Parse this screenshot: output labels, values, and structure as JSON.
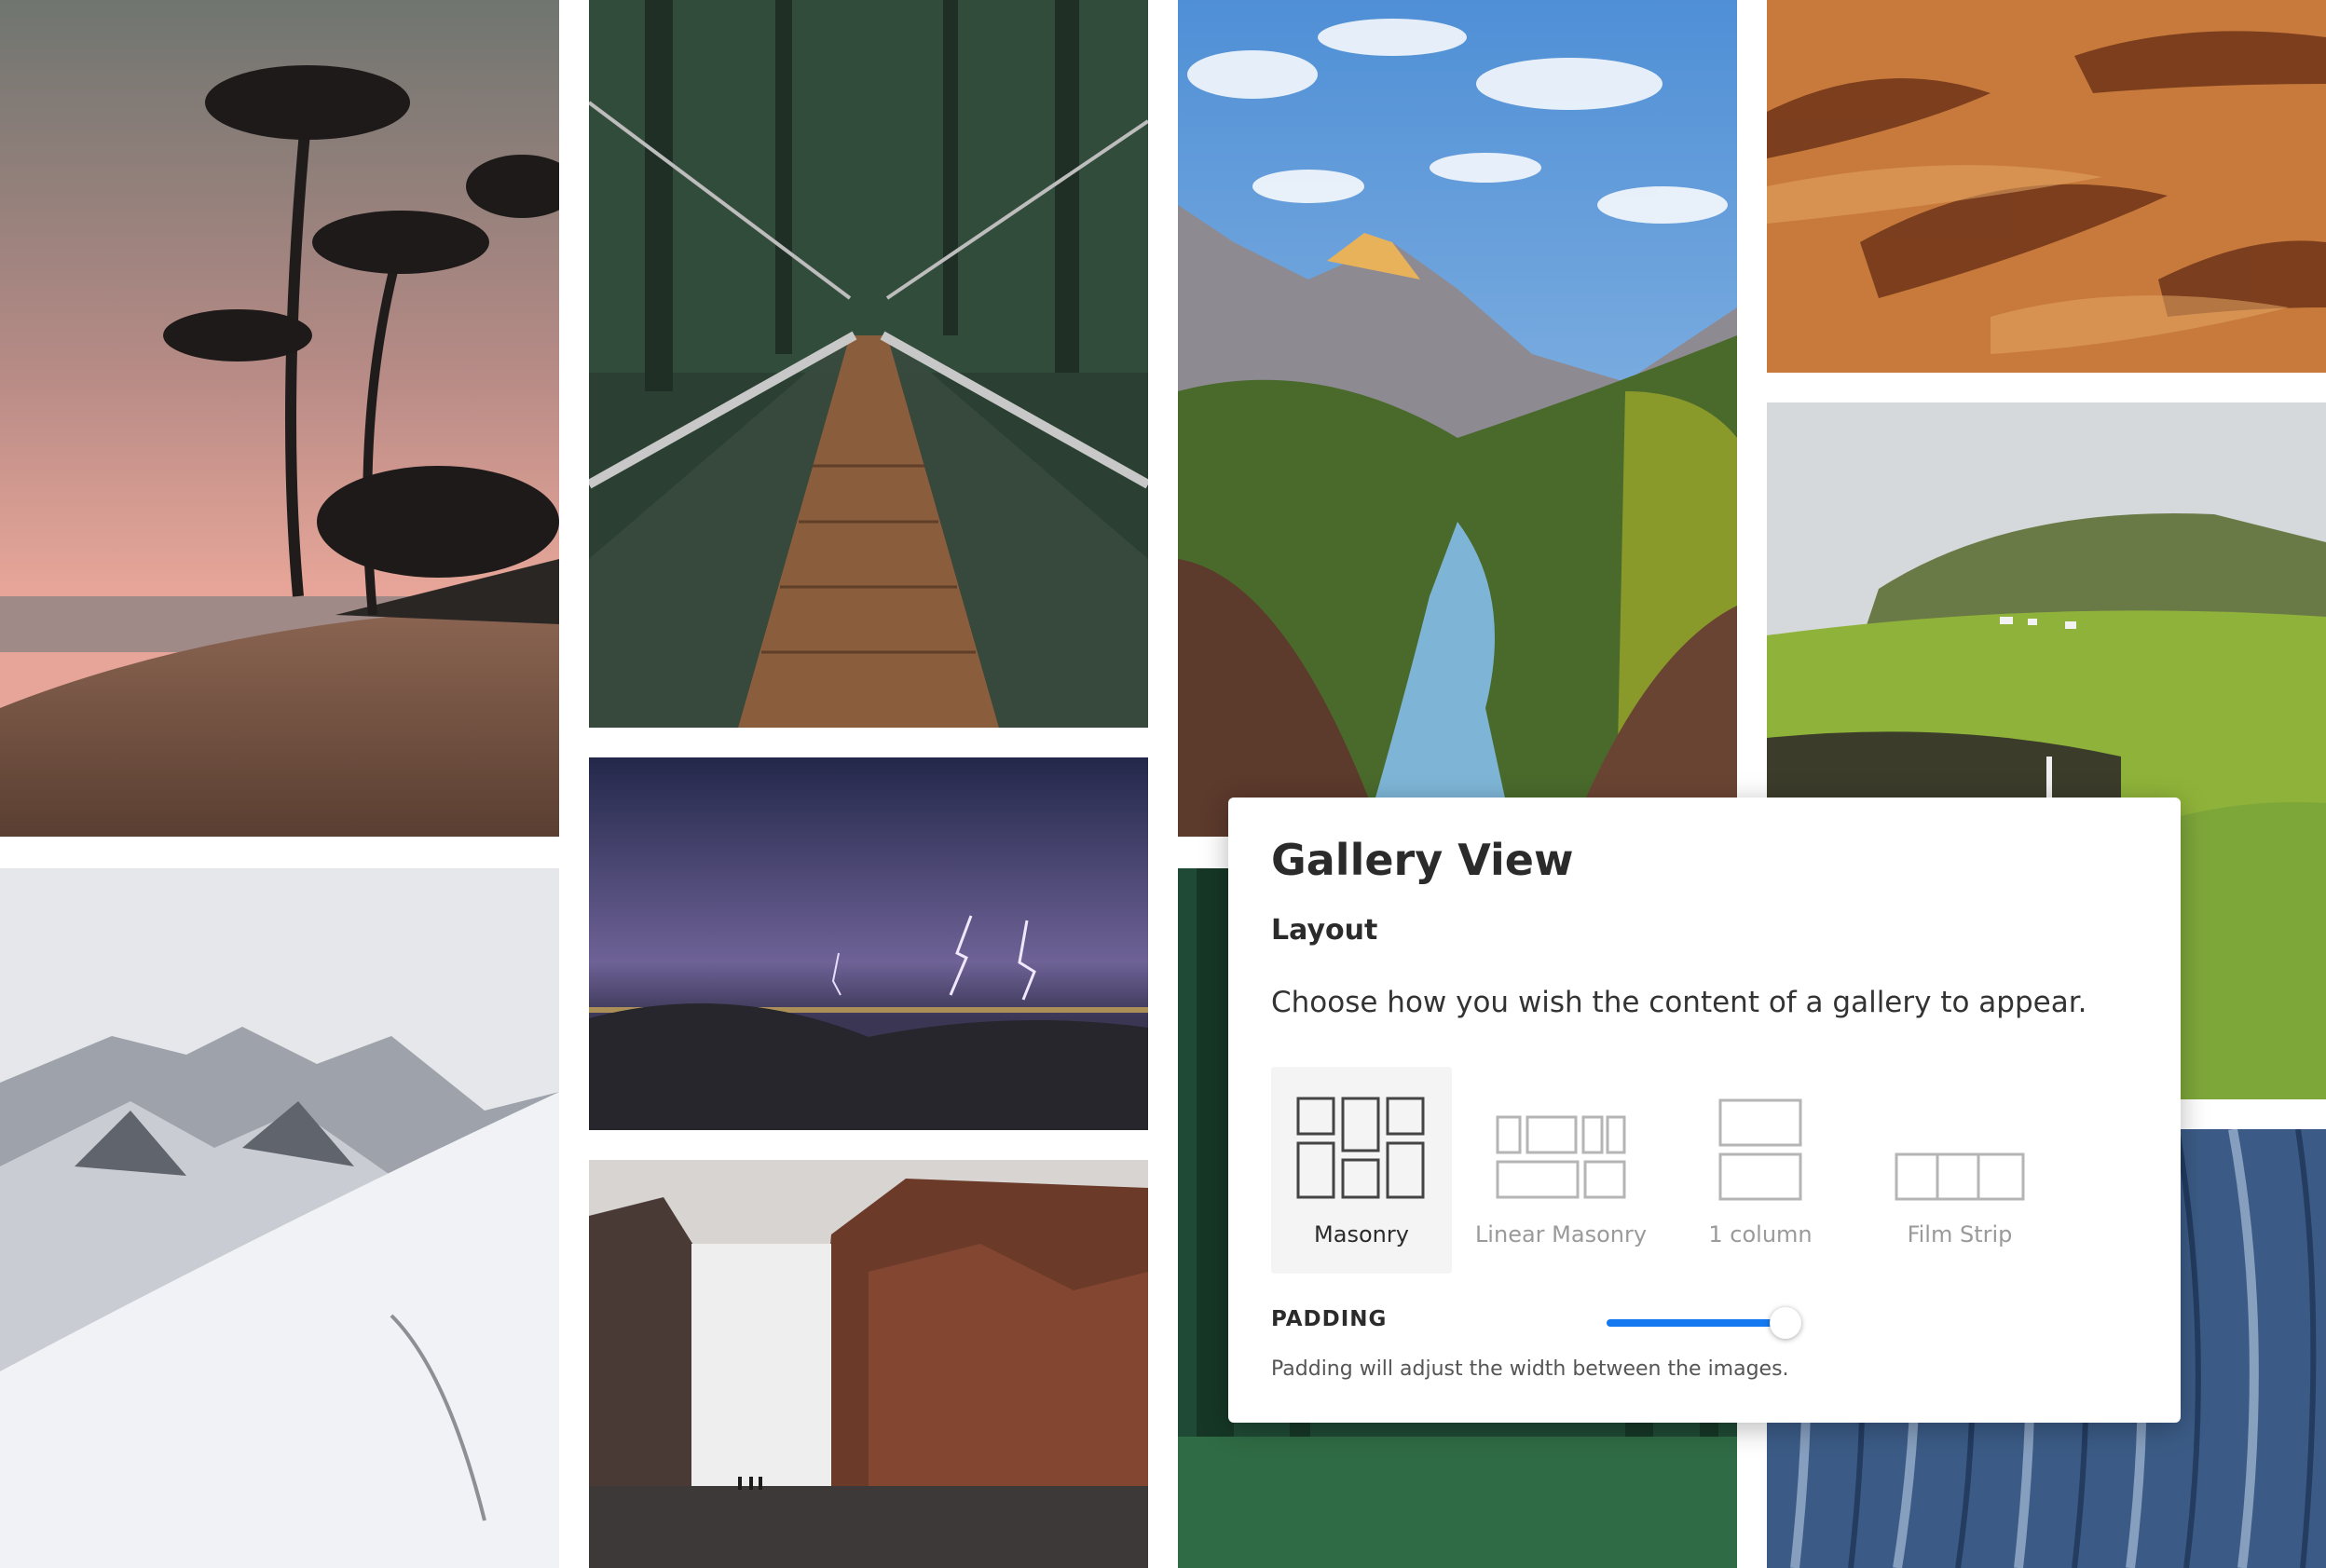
{
  "gallery": {
    "images": [
      {
        "id": "beach-sunset"
      },
      {
        "id": "snowy-mountains"
      },
      {
        "id": "suspension-bridge"
      },
      {
        "id": "lightning-storm"
      },
      {
        "id": "waterfall"
      },
      {
        "id": "canyon-river"
      },
      {
        "id": "forest-lawn"
      },
      {
        "id": "desert-dunes"
      },
      {
        "id": "green-hills"
      },
      {
        "id": "glacier-aerial"
      }
    ]
  },
  "panel": {
    "title": "Gallery View",
    "section_title": "Layout",
    "description": "Choose how you wish the content of a gallery to appear.",
    "layout_options": [
      {
        "label": "Masonry",
        "icon": "masonry-icon",
        "selected": true
      },
      {
        "label": "Linear Masonry",
        "icon": "linear-masonry-icon",
        "selected": false
      },
      {
        "label": "1 column",
        "icon": "one-column-icon",
        "selected": false
      },
      {
        "label": "Film Strip",
        "icon": "film-strip-icon",
        "selected": false
      }
    ],
    "padding": {
      "label": "PADDING",
      "help": "Padding will adjust the width between the images.",
      "value_fraction": 0.94
    },
    "colors": {
      "accent": "#1479f0",
      "selected_bg": "#f4f4f4",
      "muted_text": "#9a9a9a"
    }
  }
}
